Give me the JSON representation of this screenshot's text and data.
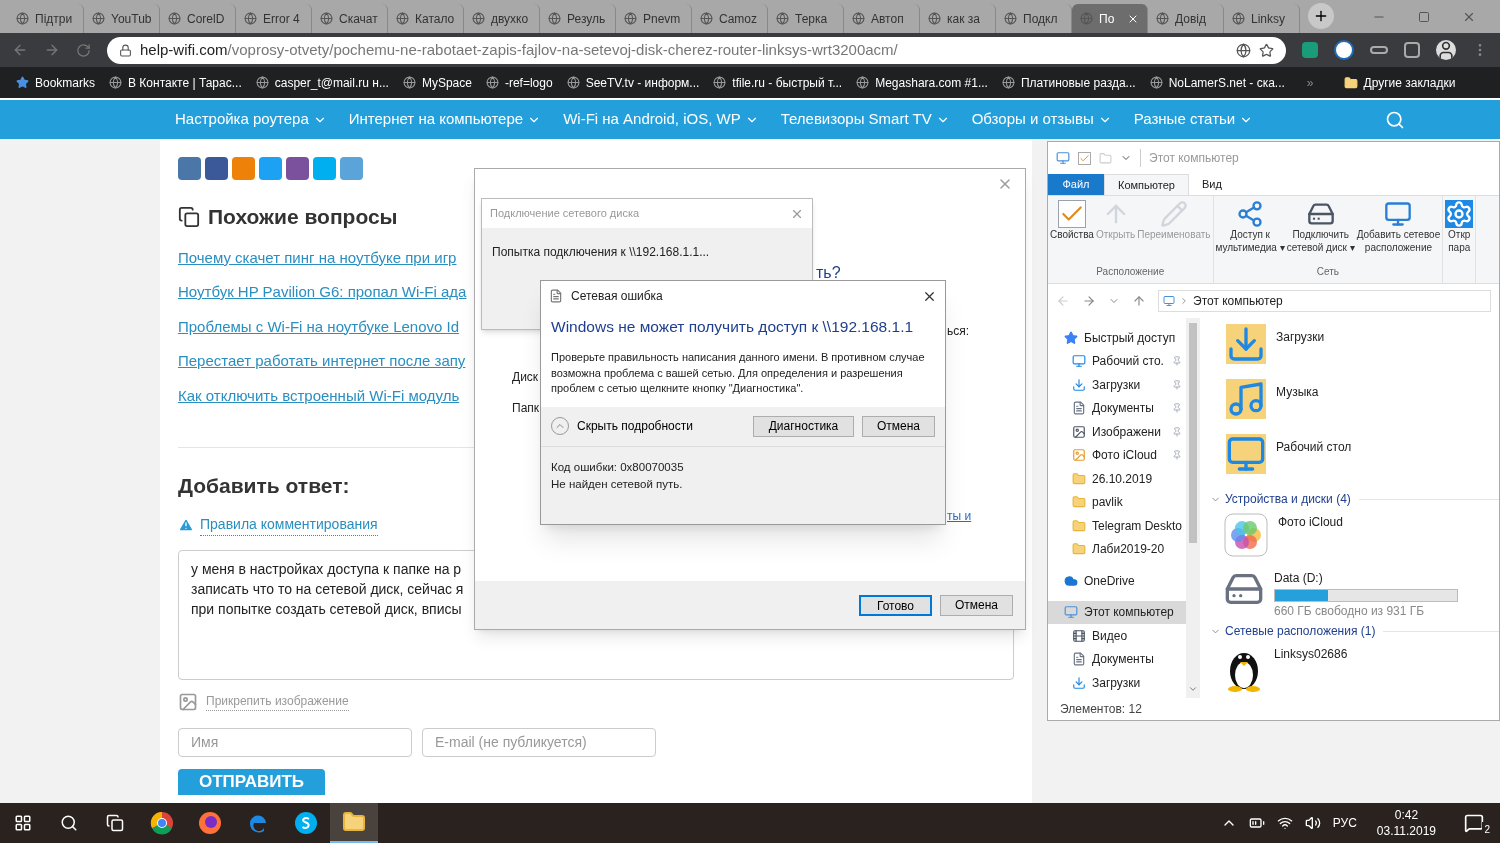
{
  "browser": {
    "tabs": [
      {
        "title": "Підтри",
        "selected": false
      },
      {
        "title": "YouTub",
        "selected": false
      },
      {
        "title": "CorelD",
        "selected": false
      },
      {
        "title": "Error 4",
        "selected": false
      },
      {
        "title": "Скачат",
        "selected": false
      },
      {
        "title": "Катало",
        "selected": false
      },
      {
        "title": "двухко",
        "selected": false
      },
      {
        "title": "Резуль",
        "selected": false
      },
      {
        "title": "Pnevm",
        "selected": false
      },
      {
        "title": "Camoz",
        "selected": false
      },
      {
        "title": "Терка",
        "selected": false
      },
      {
        "title": "Автоп",
        "selected": false
      },
      {
        "title": "как за",
        "selected": false
      },
      {
        "title": "Подкл",
        "selected": false
      },
      {
        "title": "По",
        "selected": true
      },
      {
        "title": "Довід",
        "selected": false
      },
      {
        "title": "Linksy",
        "selected": false
      }
    ],
    "url": {
      "domain": "help-wifi.com",
      "path": "/voprosy-otvety/pochemu-ne-rabotaet-zapis-fajlov-na-setevoj-disk-cherez-router-linksys-wrt3200acm/"
    },
    "bookmarks": [
      "Bookmarks",
      "В Контакте | Тарас...",
      "casper_t@mail.ru н...",
      "MySpace",
      "-ref=logo",
      "SeeTV.tv - информ...",
      "tfile.ru - быстрый т...",
      "Megashara.com #1...",
      "Платиновые разда...",
      "NoLamerS.net - ска..."
    ],
    "more_bookmarks": "»",
    "other_bookmarks": "Другие закладки"
  },
  "site": {
    "nav": [
      "Настройка роутера",
      "Интернет на компьютере",
      "Wi-Fi на Android, iOS, WP",
      "Телевизоры Smart TV",
      "Обзоры и отзывы",
      "Разные статьи"
    ],
    "similar": {
      "heading": "Похожие вопросы",
      "links": [
        "Почему скачет пинг на ноутбуке при игр",
        "Ноутбук HP Pavilion G6: пропал Wi-Fi ада",
        "Проблемы с Wi-Fi на ноутбуке Lenovo Id",
        "Перестает работать интернет после запу",
        "Как отключить встроенный Wi-Fi модуль"
      ]
    },
    "answer": {
      "heading": "Добавить ответ:",
      "rules_link": "Правила комментирования",
      "comment_lines": [
        "у меня в настройках доступа к папке на р",
        "записать что то на сетевой диск, сейчас я",
        "при попытке создать сетевой диск, вписы"
      ],
      "attach": "Прикрепить изображение",
      "name_placeholder": "Имя",
      "email_placeholder": "E-mail (не публикуется)",
      "submit": "ОТПРАВИТЬ"
    }
  },
  "wizard": {
    "fragments": [
      {
        "text": "ть?",
        "kind": "heading"
      },
      {
        "text": "ься:",
        "kind": "label"
      },
      {
        "text": "Диск",
        "kind": "label"
      },
      {
        "text": "Папк",
        "kind": "label"
      },
      {
        "text": "ты и",
        "kind": "link"
      }
    ],
    "buttons": [
      {
        "label": "Готово",
        "default": true
      },
      {
        "label": "Отмена",
        "default": false
      }
    ]
  },
  "progress_dialog": {
    "title": "Подключение сетевого диска",
    "message": "Попытка подключения к \\\\192.168.1.1..."
  },
  "error_dialog": {
    "title": "Сетевая ошибка",
    "heading": "Windows не может получить доступ к \\\\192.168.1.1",
    "body": "Проверьте правильность написания данного имени. В противном случае возможна проблема с вашей сетью. Для определения и разрешения проблем с сетью щелкните кнопку \"Диагностика\".",
    "details_toggle": "Скрыть подробности",
    "expanded": true,
    "buttons": [
      "Диагностика",
      "Отмена"
    ],
    "error_code": "Код ошибки: 0x80070035",
    "error_text": "Не найден сетевой путь."
  },
  "explorer": {
    "title": "Этот компьютер",
    "ribbon_tabs": [
      {
        "label": "Файл",
        "kind": "file",
        "selected": false
      },
      {
        "label": "Компьютер",
        "kind": "tab",
        "selected": true
      },
      {
        "label": "Вид",
        "kind": "tab",
        "selected": false
      }
    ],
    "ribbon_groups": [
      {
        "label": "Расположение",
        "buttons": [
          {
            "lines": [
              "Свойства"
            ],
            "kind": "properties",
            "disabled": false,
            "dropdown": false
          },
          {
            "lines": [
              "Открыть"
            ],
            "kind": "open",
            "disabled": true,
            "dropdown": false
          },
          {
            "lines": [
              "Переименовать"
            ],
            "kind": "rename",
            "disabled": true,
            "dropdown": false
          }
        ]
      },
      {
        "label": "Сеть",
        "buttons": [
          {
            "lines": [
              "Доступ к",
              "мультимедиа"
            ],
            "kind": "media",
            "disabled": false,
            "dropdown": true,
            "dropdown_mark": "▾"
          },
          {
            "lines": [
              "Подключить",
              "сетевой диск"
            ],
            "kind": "drive",
            "disabled": false,
            "dropdown": true,
            "dropdown_mark": "▾"
          },
          {
            "lines": [
              "Добавить сетевое",
              "расположение"
            ],
            "kind": "netloc",
            "disabled": false,
            "dropdown": false
          }
        ]
      },
      {
        "buttons": [
          {
            "lines": [
              "Откр",
              "пара"
            ],
            "kind": "settings",
            "disabled": false,
            "dropdown": false
          }
        ]
      }
    ],
    "address": "Этот компьютер",
    "nav": [
      {
        "label": "Быстрый доступ",
        "kind": "star",
        "selected": false,
        "children": [
          {
            "label": "Рабочий сто.",
            "kind": "desktop",
            "pinned": true,
            "selected": false
          },
          {
            "label": "Загрузки",
            "kind": "download",
            "pinned": true,
            "selected": false
          },
          {
            "label": "Документы",
            "kind": "doc",
            "pinned": true,
            "selected": false
          },
          {
            "label": "Изображени",
            "kind": "pictures",
            "pinned": true,
            "selected": false
          },
          {
            "label": "Фото iCloud",
            "kind": "photo",
            "pinned": true,
            "selected": false
          },
          {
            "label": "26.10.2019",
            "kind": "folder",
            "pinned": false,
            "selected": false
          },
          {
            "label": "pavlik",
            "kind": "folder",
            "pinned": false,
            "selected": false
          },
          {
            "label": "Telegram Deskto",
            "kind": "folder",
            "pinned": false,
            "selected": false
          },
          {
            "label": "Лаби2019-20",
            "kind": "folder",
            "pinned": false,
            "selected": false
          }
        ]
      },
      {
        "label": "OneDrive",
        "kind": "cloud",
        "selected": false
      },
      {
        "label": "Этот компьютер",
        "kind": "pc",
        "selected": true,
        "children": [
          {
            "label": "Видео",
            "kind": "video",
            "pinned": false,
            "selected": false
          },
          {
            "label": "Документы",
            "kind": "doc",
            "pinned": false,
            "selected": false
          },
          {
            "label": "Загрузки",
            "kind": "download",
            "pinned": false,
            "selected": false
          }
        ]
      }
    ],
    "folders": [
      {
        "label": "Загрузки",
        "kind": "download"
      },
      {
        "label": "Музыка",
        "kind": "music"
      },
      {
        "label": "Рабочий стол",
        "kind": "desktop"
      }
    ],
    "sections": [
      {
        "title": "Устройства и диски (4)",
        "items": [
          {
            "label": "Фото iCloud",
            "kind": "icloud"
          },
          {
            "label": "Data (D:)",
            "kind": "disk",
            "level": 0.29,
            "reading": "660 ГБ свободно из 931 ГБ"
          }
        ]
      },
      {
        "title": "Сетевые расположения (1)",
        "items": [
          {
            "label": "Linksys02686",
            "kind": "penguin"
          }
        ]
      }
    ],
    "status": "Элементов: 12"
  },
  "taskbar": {
    "apps": [
      {
        "kind": "chrome",
        "active": false
      },
      {
        "kind": "firefox",
        "active": false
      },
      {
        "kind": "edge",
        "active": false
      },
      {
        "kind": "skype",
        "active": false
      },
      {
        "kind": "explorer",
        "active": true
      }
    ],
    "lang": "РУС",
    "time": "0:42",
    "date": "03.11.2019",
    "notifications": "2"
  }
}
